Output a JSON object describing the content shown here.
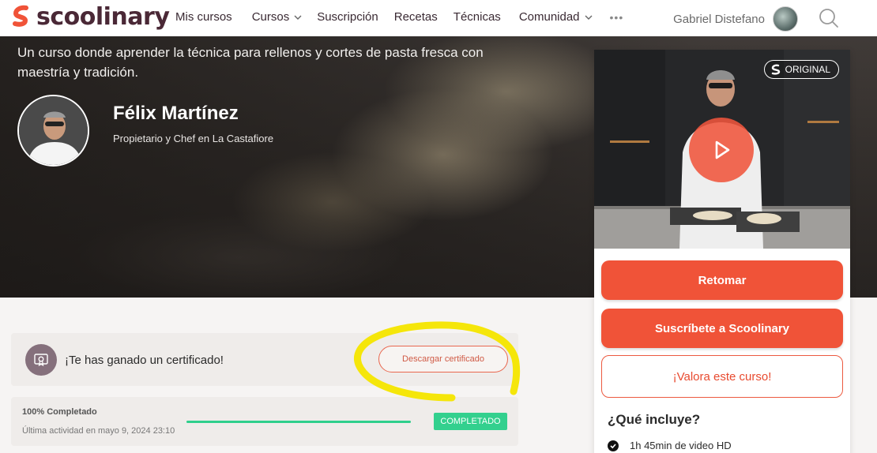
{
  "header": {
    "logo_text": "scoolinary",
    "nav": [
      {
        "label": "Mis cursos",
        "has_dropdown": false
      },
      {
        "label": "Cursos",
        "has_dropdown": true
      },
      {
        "label": "Suscripción",
        "has_dropdown": false
      },
      {
        "label": "Recetas",
        "has_dropdown": false
      },
      {
        "label": "Técnicas",
        "has_dropdown": false
      },
      {
        "label": "Comunidad",
        "has_dropdown": true
      }
    ],
    "more_label": "•••",
    "user_name": "Gabriel Distefano",
    "icons": {
      "search": "search-icon",
      "more": "more-icon"
    }
  },
  "hero": {
    "description": "Un curso donde aprender la técnica para rellenos y cortes de pasta fresca con maestría y tradición.",
    "chef_name": "Félix Martínez",
    "chef_role": "Propietario y Chef en La Castafiore"
  },
  "card": {
    "badge_label": "ORIGINAL",
    "buttons": {
      "resume": "Retomar",
      "subscribe": "Suscríbete a Scoolinary",
      "rate": "¡Valora este curso!"
    },
    "includes_title": "¿Qué incluye?",
    "includes": [
      "1h 45min de video HD"
    ]
  },
  "certificate": {
    "text": "¡Te has ganado un certificado!",
    "button": "Descargar certificado"
  },
  "progress": {
    "title": "100% Completado",
    "last_activity": "Última actividad en mayo 9, 2024 23:10",
    "percent": 100,
    "badge": "COMPLETADO"
  },
  "colors": {
    "accent": "#f05338",
    "brand": "#4a2836",
    "success": "#33d08e",
    "highlight": "#f5e60a"
  }
}
